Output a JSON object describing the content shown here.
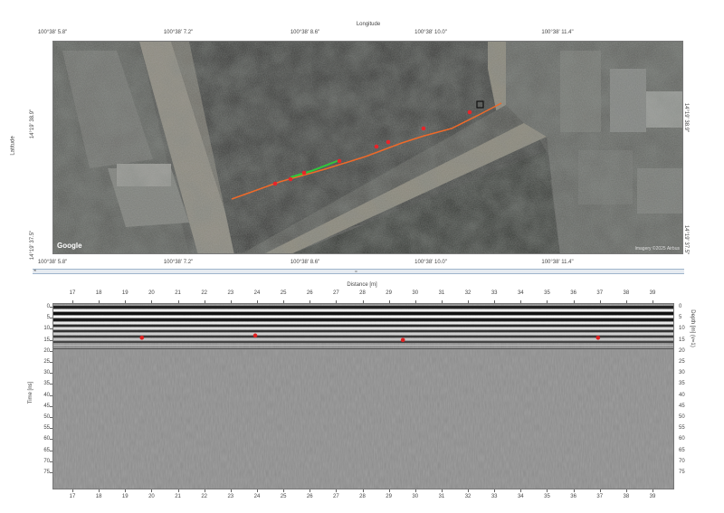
{
  "map": {
    "axis_title_top": "Longitude",
    "axis_title_left": "Latitude",
    "lon_ticks": [
      "100°38' 5.8\"",
      "100°38' 7.2\"",
      "100°38' 8.6\"",
      "100°38' 10.0\"",
      "100°38' 11.4\""
    ],
    "lat_ticks": [
      "14°19' 38.9\"",
      "14°19' 37.5\""
    ],
    "google_label": "Google",
    "imagery_credit": "Imagery ©2025 Airbus",
    "colors": {
      "track": "#ee6a2a",
      "marker": "#e8242a",
      "segment": "#2fc83a",
      "cursor": "#111111"
    }
  },
  "splitter": {
    "grip": "=",
    "scroll_arrow": "◂"
  },
  "radar": {
    "axis_title_top": "Distance [m]",
    "axis_title_left": "Time [ns]",
    "axis_title_right": "Depth [m] (v=1)",
    "distance_ticks": [
      "17",
      "18",
      "19",
      "20",
      "21",
      "22",
      "23",
      "24",
      "25",
      "26",
      "27",
      "28",
      "29",
      "30",
      "31",
      "32",
      "33",
      "34",
      "35",
      "36",
      "37",
      "38",
      "39"
    ],
    "time_ticks": [
      "0",
      "5",
      "10",
      "15",
      "20",
      "25",
      "30",
      "35",
      "40",
      "45",
      "50",
      "55",
      "60",
      "65",
      "70",
      "75"
    ],
    "markers_color": "#e02020"
  }
}
